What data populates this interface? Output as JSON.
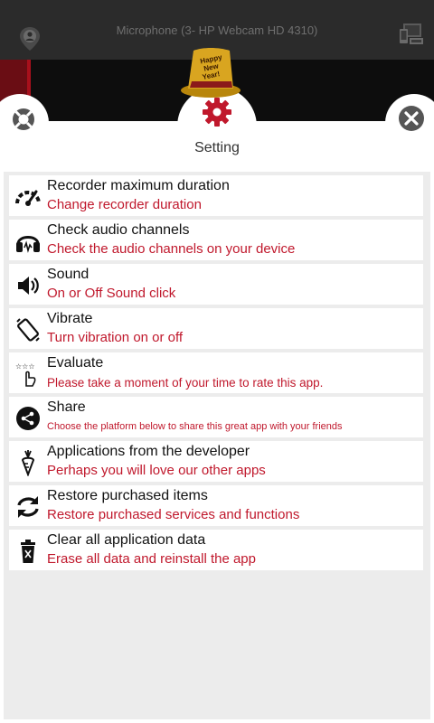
{
  "topbar": {
    "title": "Microphone (3- HP Webcam HD 4310)",
    "left_icon": "location-pin-icon",
    "right_icon": "devices-icon"
  },
  "header": {
    "title": "Setting",
    "left_icon": "lifebuoy-icon",
    "center_icon": "gear-icon",
    "right_icon": "close-icon",
    "decoration": "new-year-hat-icon",
    "hat_text": "Happy New Year!"
  },
  "colors": {
    "accent": "#c0182c",
    "topbar": "#2b2b2b",
    "panel": "#ececec"
  },
  "settings": [
    {
      "icon": "speedometer-icon",
      "title": "Recorder maximum duration",
      "subtitle": "Change recorder duration"
    },
    {
      "icon": "headphones-icon",
      "title": "Check audio channels",
      "subtitle": "Check the audio channels on your device"
    },
    {
      "icon": "speaker-icon",
      "title": "Sound",
      "subtitle": "On or Off Sound click"
    },
    {
      "icon": "vibrate-phone-icon",
      "title": "Vibrate",
      "subtitle": "Turn vibration on or off"
    },
    {
      "icon": "rate-stars-icon",
      "title": "Evaluate",
      "subtitle": "Please take a moment of your time to rate this app."
    },
    {
      "icon": "share-icon",
      "title": "Share",
      "subtitle": "Choose the platform below to share this great app with your friends"
    },
    {
      "icon": "carrot-icon",
      "title": "Applications from the developer",
      "subtitle": "Perhaps you will love our other apps"
    },
    {
      "icon": "restore-arrows-icon",
      "title": "Restore purchased items",
      "subtitle": "Restore purchased services and functions"
    },
    {
      "icon": "trash-icon",
      "title": "Clear all application data",
      "subtitle": "Erase all data and reinstall the app"
    }
  ]
}
